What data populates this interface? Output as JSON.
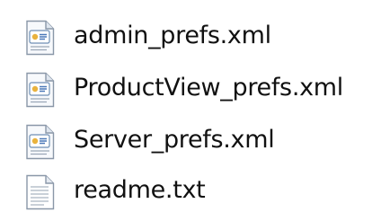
{
  "files": [
    {
      "name": "admin_prefs.xml",
      "icon": "xml-file-icon"
    },
    {
      "name": "ProductView_prefs.xml",
      "icon": "xml-file-icon"
    },
    {
      "name": "Server_prefs.xml",
      "icon": "xml-file-icon"
    },
    {
      "name": "readme.txt",
      "icon": "text-file-icon"
    }
  ]
}
